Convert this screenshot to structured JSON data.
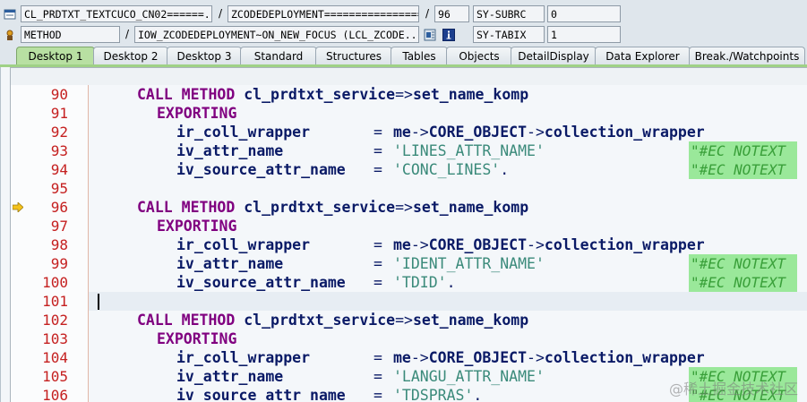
{
  "debugger": {
    "row1": {
      "program": "CL_PRDTXT_TEXTCUCO_CN02======...",
      "include": "ZCODEDEPLOYMENT=================...",
      "line": "96",
      "sysvar": "SY-SUBRC",
      "sysval": "0"
    },
    "row2": {
      "event_type": "METHOD",
      "event": "IOW_ZCODEDEPLOYMENT~ON_NEW_FOCUS (LCL_ZCODE...",
      "sysvar": "SY-TABIX",
      "sysval": "1"
    }
  },
  "tabs": [
    {
      "label": "Desktop 1",
      "active": true
    },
    {
      "label": "Desktop 2"
    },
    {
      "label": "Desktop 3"
    },
    {
      "label": "Standard"
    },
    {
      "label": "Structures"
    },
    {
      "label": "Tables"
    },
    {
      "label": "Objects"
    },
    {
      "label": "DetailDisplay"
    },
    {
      "label": "Data Explorer"
    },
    {
      "label": "Break./Watchpoints"
    }
  ],
  "code": {
    "lines": [
      {
        "no": "90"
      },
      {
        "no": "91"
      },
      {
        "no": "92"
      },
      {
        "no": "93",
        "comment": "\"#EC NOTEXT"
      },
      {
        "no": "94",
        "comment": "\"#EC NOTEXT"
      },
      {
        "no": "95"
      },
      {
        "no": "96"
      },
      {
        "no": "97"
      },
      {
        "no": "98"
      },
      {
        "no": "99",
        "comment": "\"#EC NOTEXT"
      },
      {
        "no": "100",
        "comment": "\"#EC NOTEXT"
      },
      {
        "no": "101"
      },
      {
        "no": "102"
      },
      {
        "no": "103"
      },
      {
        "no": "104"
      },
      {
        "no": "105",
        "comment": "\"#EC NOTEXT"
      },
      {
        "no": "106",
        "comment": "\"#EC NOTEXT"
      }
    ],
    "text": {
      "call": "CALL METHOD",
      "obj": "cl_prdtxt_service",
      "arrow": "=>",
      "method": "set_name_komp",
      "exporting": "EXPORTING",
      "p1": "ir_coll_wrapper",
      "eq": "=",
      "me": "me",
      "arrow2": "->",
      "core": "CORE_OBJECT",
      "arrow3": "->",
      "coll": "collection_wrapper",
      "p2": "iv_attr_name",
      "p3": "iv_source_attr_name",
      "v93": "'LINES_ATTR_NAME'",
      "v94": "'CONC_LINES'",
      "v99": "'IDENT_ATTR_NAME'",
      "v100": "'TDID'",
      "v105": "'LANGU_ATTR_NAME'",
      "v106": "'TDSPRAS'",
      "dot": "."
    }
  },
  "watermark": "@稀土掘金技术社区"
}
